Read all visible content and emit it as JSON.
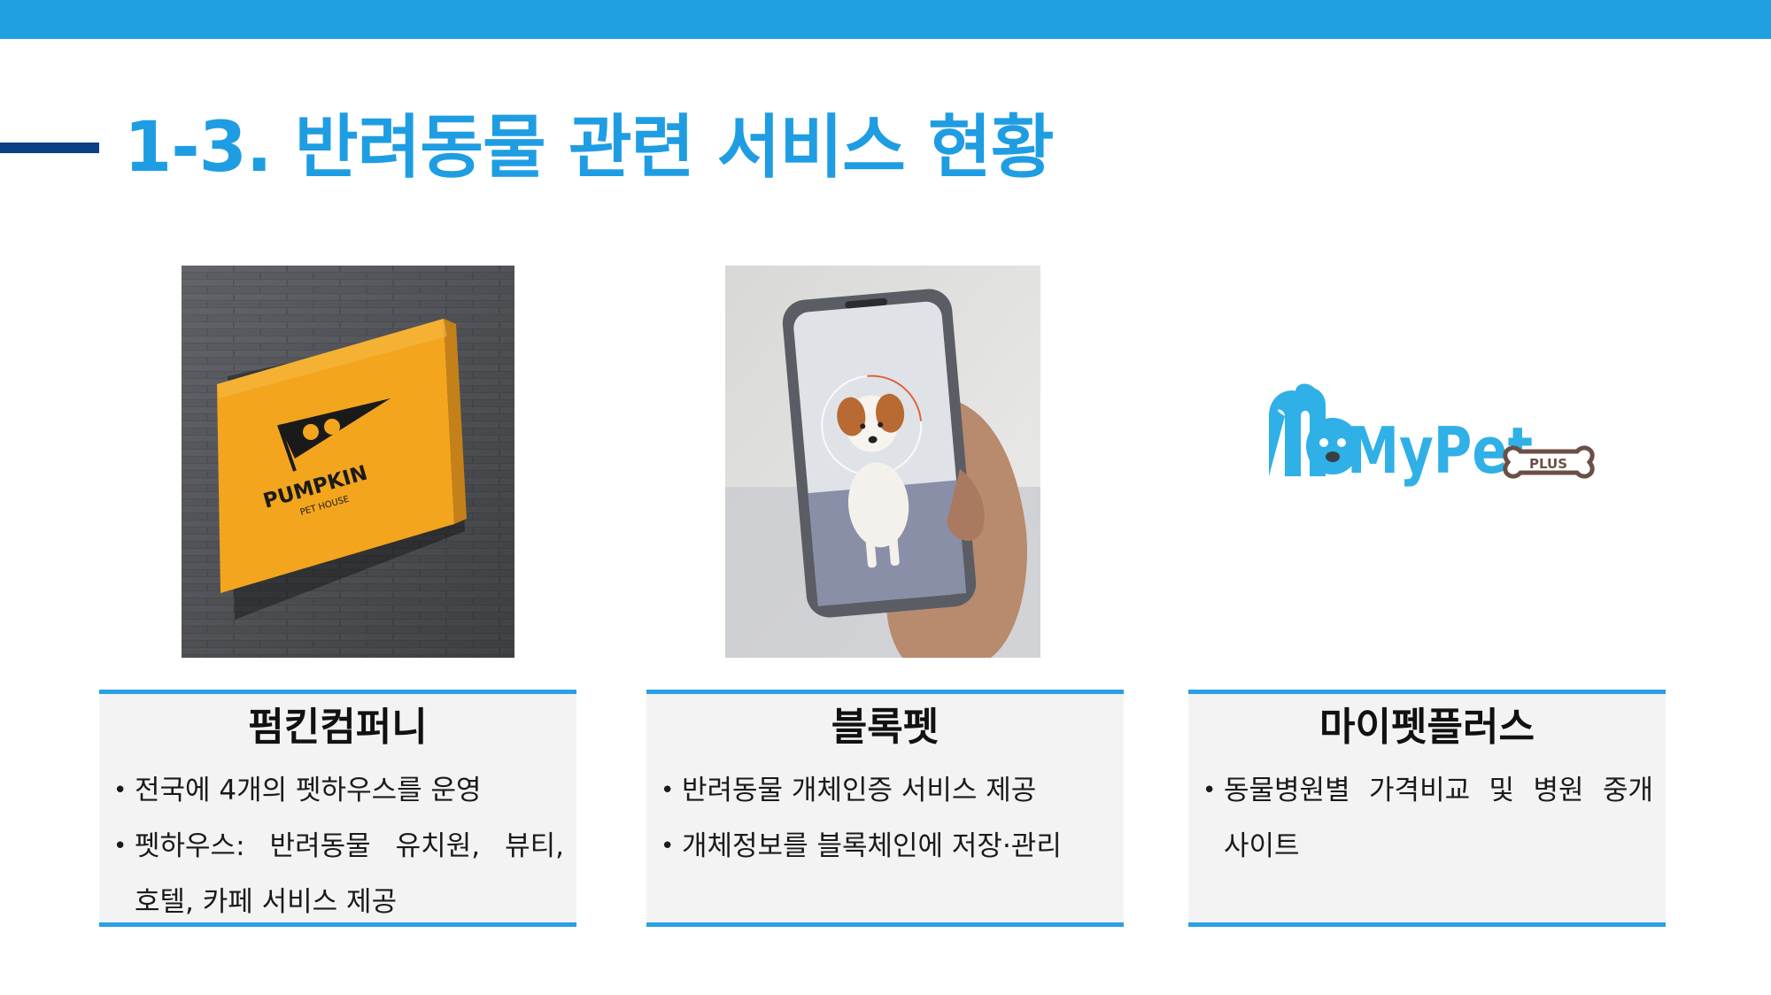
{
  "page": {
    "title": "1-3. 반려동물 관련 서비스 현황"
  },
  "colors": {
    "top_bar": "#20a0e0",
    "title": "#1f9de2",
    "title_rule": "#0d3f86",
    "card_border": "#29a1e1",
    "card_bg": "#f3f3f3",
    "sign_orange": "#f3a51d"
  },
  "images": {
    "pumpkin_sign": {
      "brand": "PUMPKIN",
      "subtitle": "PET HOUSE"
    },
    "mypet_logo": {
      "wordmark": "MyPet",
      "badge": "PLUS"
    }
  },
  "services": [
    {
      "name": "펌킨컴퍼니",
      "bullets": [
        "전국에 4개의 펫하우스를 운영",
        "펫하우스: 반려동물 유치원, 뷰티,",
        "호텔, 카페 서비스 제공"
      ]
    },
    {
      "name": "블록펫",
      "bullets": [
        "반려동물 개체인증 서비스 제공",
        "개체정보를 블록체인에 저장·관리"
      ]
    },
    {
      "name": "마이펫플러스",
      "bullets": [
        "동물병원별 가격비교 및 병원 중개",
        "사이트"
      ]
    }
  ]
}
